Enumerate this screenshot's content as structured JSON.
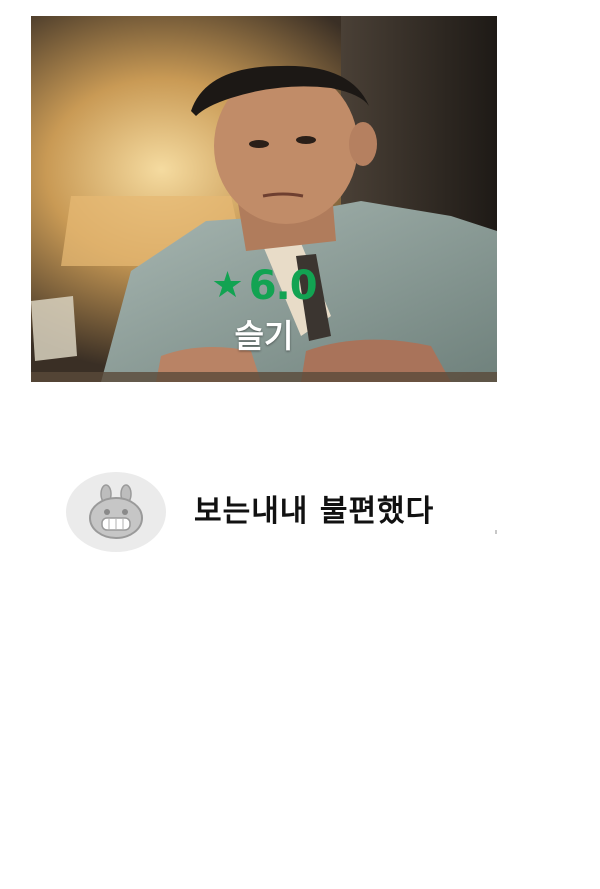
{
  "card": {
    "rating_star": "★",
    "rating_value": "6.0",
    "character_name": "슬기",
    "photo": "man-in-grey-suit-photo",
    "accent_color": "#12a352"
  },
  "comment": {
    "avatar_icon": "bunny-avatar-icon",
    "text": "보는내내 불편했다"
  }
}
